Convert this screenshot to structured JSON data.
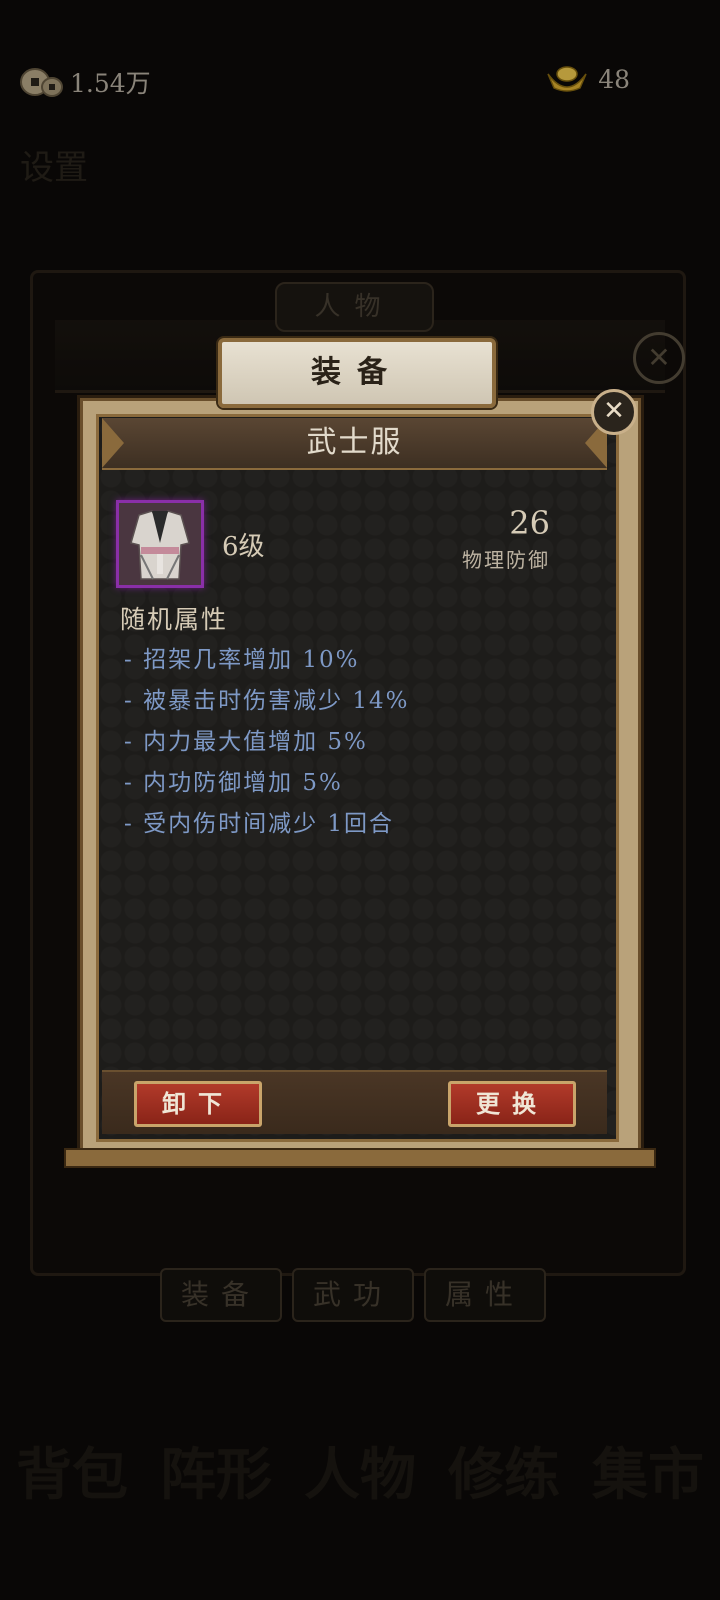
{
  "currency": {
    "coin_icon": "copper-coin-icon",
    "coin_amount": "1.54万",
    "gold_icon": "gold-ingot-icon",
    "gold_amount": "48"
  },
  "background": {
    "panel_title": "人物",
    "tabs": [
      "装备",
      "武功",
      "属性"
    ],
    "nav": [
      "背包",
      "阵形",
      "人物",
      "修练",
      "集市"
    ]
  },
  "modal": {
    "header_tab": "装备",
    "item_name": "武士服",
    "item_icon": "samurai-robe-icon",
    "item_rarity_color": "#8a2fa8",
    "level": "6级",
    "stat_value": "26",
    "stat_label": "物理防御",
    "random_attr_title": "随机属性",
    "random_attrs": [
      "- 招架几率增加 10%",
      "- 被暴击时伤害减少 14%",
      "- 内力最大值增加 5%",
      "- 内功防御增加 5%",
      "- 受内伤时间减少 1回合"
    ],
    "buttons": {
      "unequip": "卸下",
      "replace": "更换"
    },
    "close_icon": "close-icon"
  },
  "colors": {
    "attr_text": "#7e99c6",
    "button_red": "#b23a2a",
    "frame_gold": "#8a6a3c"
  }
}
